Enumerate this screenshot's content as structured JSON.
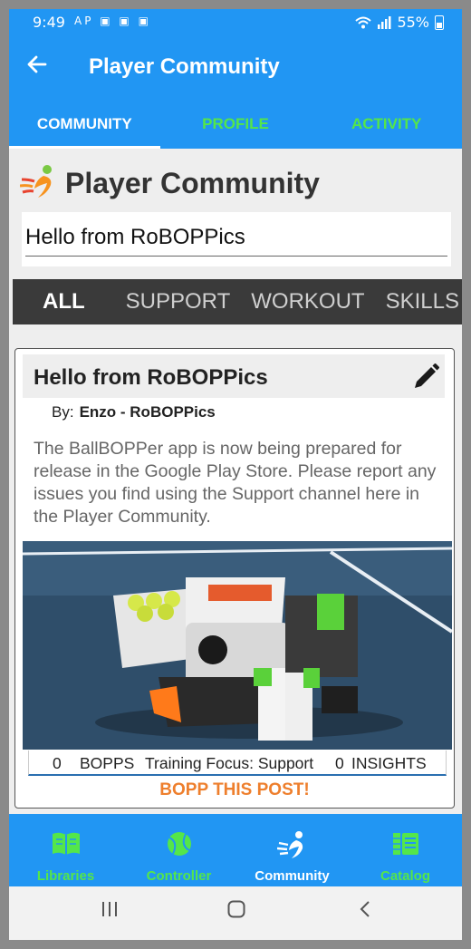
{
  "status_bar": {
    "time": "9:49",
    "notification_icons": "AP ▣ ▣ ▣",
    "battery": "55%"
  },
  "app_bar": {
    "title": "Player Community",
    "back_icon": "arrow-left-icon"
  },
  "tabs": [
    {
      "label": "COMMUNITY",
      "active": true
    },
    {
      "label": "PROFILE",
      "active": false
    },
    {
      "label": "ACTIVITY",
      "active": false
    }
  ],
  "header": {
    "title": "Player Community",
    "logo_icon": "runner-logo-icon"
  },
  "search": {
    "value": "Hello from RoBOPPics"
  },
  "categories": [
    {
      "label": "ALL",
      "active": true
    },
    {
      "label": "SUPPORT",
      "active": false
    },
    {
      "label": "WORKOUT",
      "active": false
    },
    {
      "label": "SKILLS",
      "active": false
    }
  ],
  "post": {
    "title": "Hello from RoBOPPics",
    "by_label": "By:",
    "author": "Enzo - RoBOPPics",
    "body": "The BallBOPPer app is now being prepared for release in the Google Play Store. Please report any issues you find using the Support channel here in the Player Community.",
    "bopps_count": "0",
    "bopps_label": "BOPPS",
    "focus": "Training Focus: Support",
    "insights_count": "0",
    "insights_label": "INSIGHTS",
    "action": "BOPP THIS POST!"
  },
  "bottom_nav": [
    {
      "label": "Libraries",
      "icon": "book-icon",
      "active": false
    },
    {
      "label": "Controller",
      "icon": "tennis-ball-icon",
      "active": false
    },
    {
      "label": "Community",
      "icon": "runner-icon",
      "active": true
    },
    {
      "label": "Catalog",
      "icon": "catalog-icon",
      "active": false
    }
  ],
  "colors": {
    "primary": "#2196f3",
    "accent_green": "#54e64a",
    "accent_orange": "#ee7f2d",
    "category_bar": "#3a3a3a"
  }
}
